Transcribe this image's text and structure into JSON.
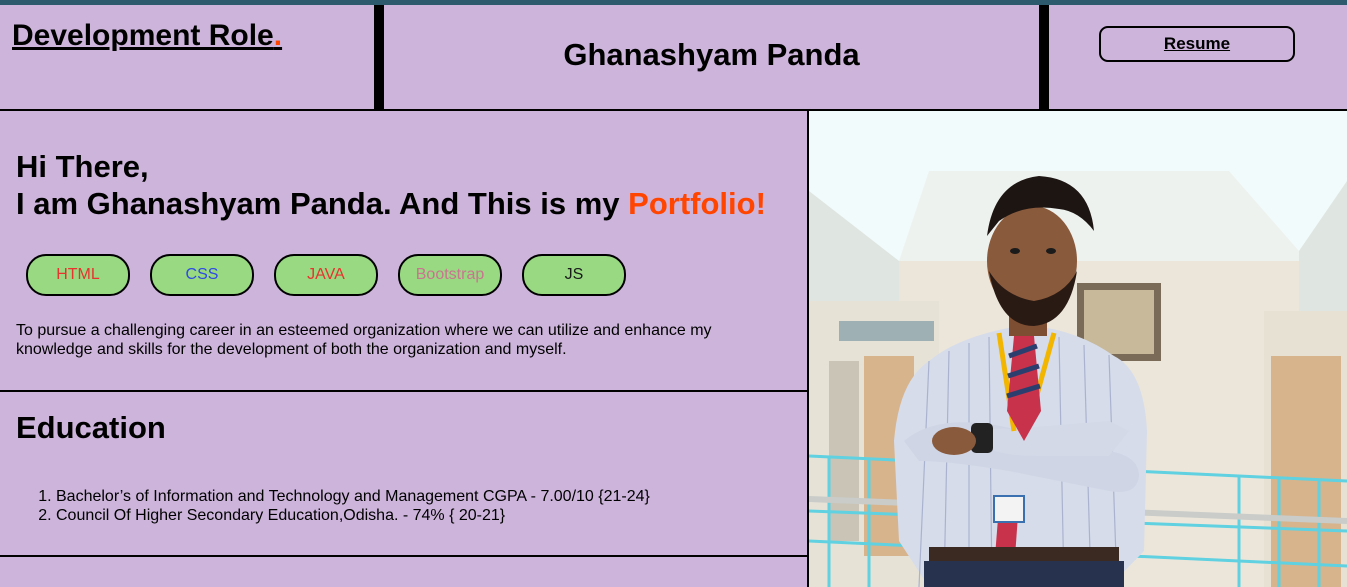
{
  "header": {
    "brand": "Development Role",
    "brand_dot": ".",
    "name": "Ghanashyam Panda",
    "resume_label": "Resume"
  },
  "intro": {
    "greeting_line1": "Hi There,",
    "greeting_line2": "I am Ghanashyam Panda. And This is my ",
    "greeting_highlight": "Portfolio!",
    "skills": [
      {
        "label": "HTML",
        "color": "#e8332e"
      },
      {
        "label": "CSS",
        "color": "#2f49e6"
      },
      {
        "label": "JAVA",
        "color": "#e8332e"
      },
      {
        "label": "Bootstrap",
        "color": "#c9758f"
      },
      {
        "label": "JS",
        "color": "#1a1a1a"
      }
    ],
    "objective": "To pursue a challenging career in an esteemed organization where we can utilize and enhance my knowledge and skills for the development of both the organization and myself."
  },
  "education": {
    "title": "Education",
    "items": [
      "Bachelor’s of Information and Technology and Management CGPA - 7.00/10 {21-24}",
      "Council Of Higher Secondary Education,Odisha. - 74% { 20-21}"
    ]
  },
  "colors": {
    "background": "#cdb4db",
    "accent": "#ff4500",
    "skill_pill": "#98d982",
    "top_strip": "#2e5a6e"
  }
}
